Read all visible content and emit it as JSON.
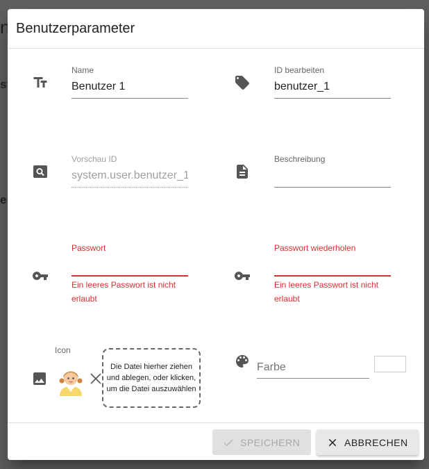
{
  "background": {
    "frag_top": "n",
    "frag_mid1": "st",
    "frag_mid2": "er"
  },
  "dialog": {
    "title": "Benutzerparameter",
    "fields": {
      "name": {
        "label": "Name",
        "value": "Benutzer 1"
      },
      "id_edit": {
        "label": "ID bearbeiten",
        "value": "benutzer_1"
      },
      "preview_id": {
        "label": "Vorschau ID",
        "value": "system.user.benutzer_1"
      },
      "description": {
        "label": "Beschreibung",
        "value": ""
      },
      "password": {
        "label": "Passwort",
        "value": "",
        "error": "Ein leeres Passwort ist nicht erlaubt"
      },
      "password_repeat": {
        "label": "Passwort wiederholen",
        "value": "",
        "error": "Ein leeres Passwort ist nicht erlaubt"
      },
      "icon": {
        "label": "Icon",
        "dropzone_text": "Die Datei hierher ziehen und ablegen, oder klicken, um die Datei auszuwählen"
      },
      "color": {
        "placeholder": "Farbe",
        "value": ""
      }
    },
    "buttons": {
      "save_label": "SPEICHERN",
      "cancel_label": "ABBRECHEN"
    },
    "colors": {
      "error": "#d32f2f",
      "icon_gray": "#555555"
    }
  }
}
